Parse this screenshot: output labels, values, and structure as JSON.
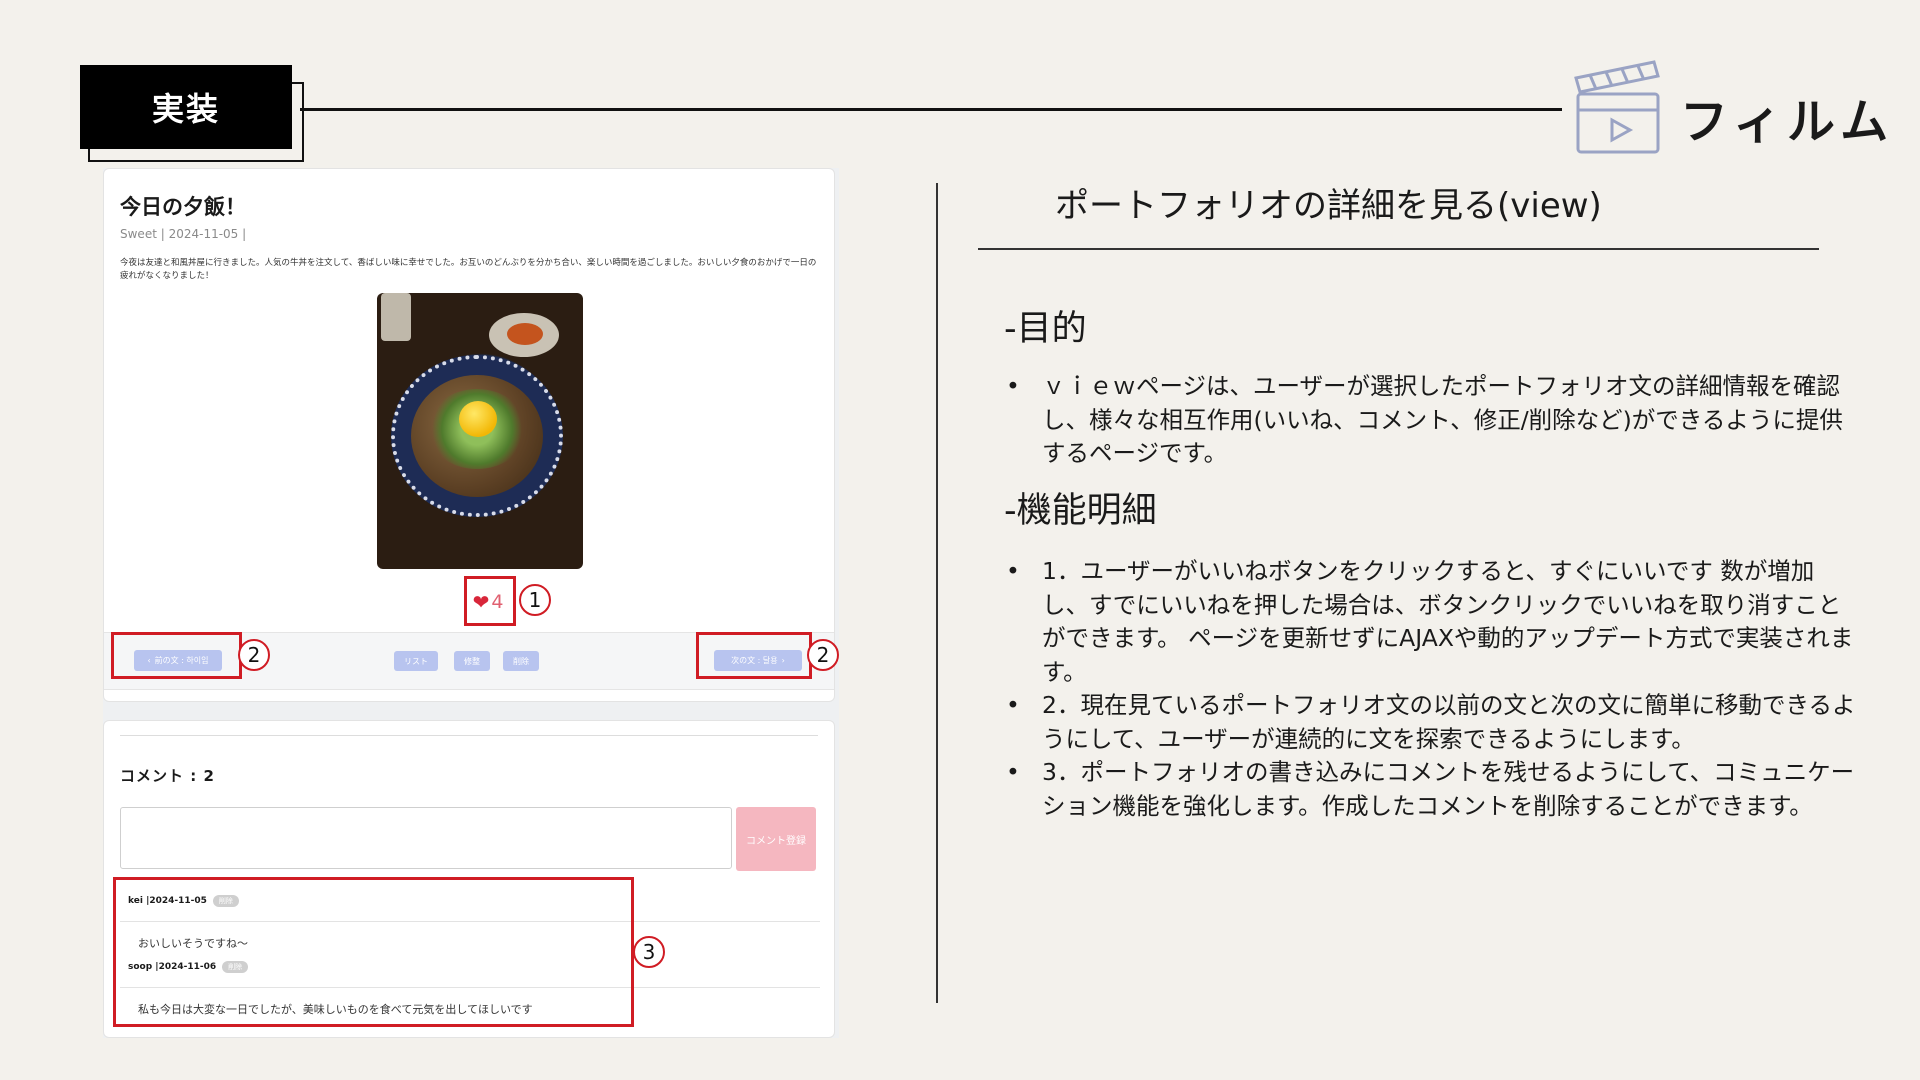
{
  "header": {
    "tag": "実装",
    "brand": "フィルム"
  },
  "post": {
    "title": "今日の夕飯！",
    "meta": "Sweet | 2024-11-05 |",
    "body": "今夜は友達と和風丼屋に行きました。人気の牛丼を注文して、香ばしい味に幸せでした。お互いのどんぶりを分かち合い、楽しい時間を過ごしました。おいしい夕食のおかげで一日の疲れがなくなりました！",
    "like_icon": "heart-icon",
    "like_count": "4",
    "prev_label": "前の文 : 하이임",
    "next_label": "次の文 : 달용",
    "list_label": "リスト",
    "edit_label": "修整",
    "delete_label": "削除"
  },
  "comments": {
    "count_label": "コメント : 2",
    "submit_label": "コメント登録",
    "items": [
      {
        "author_date": "kei |2024-11-05",
        "delete": "削除",
        "text": "おいしいそうですね～"
      },
      {
        "author_date": "soop |2024-11-06",
        "delete": "削除",
        "text": "私も今日は大変な一日でしたが、美味しいものを食べて元気を出してほしいです"
      }
    ]
  },
  "annotations": {
    "n1": "1",
    "n2": "2",
    "n3": "3"
  },
  "description": {
    "title": "ポートフォリオの詳細を見る(view)",
    "purpose_heading": "-目的",
    "purpose_text": "ｖｉｅｗページは、ユーザーが選択したポートフォリオ文の詳細情報を確認し、様々な相互作用(いいね、コメント、修正/削除など)ができるように提供するページです。",
    "features_heading": "-機能明細",
    "features": [
      "1．ユーザーがいいねボタンをクリックすると、すぐにいいです 数が増加し、すでにいいねを押した場合は、ボタンクリックでいいねを取り消すことができます。 ページを更新せずにAJAXや動的アップデート方式で実装されます。",
      "2．現在見ているポートフォリオ文の以前の文と次の文に簡単に移動できるようにして、ユーザーが連続的に文を探索できるようにします。",
      "3．ポートフォリオの書き込みにコメントを残せるようにして、コミュニケーション機能を強化します。作成したコメントを削除することができます。"
    ]
  },
  "colors": {
    "annotation_red": "#d01c24",
    "like_red": "#d8263a",
    "chip_blue": "#b8c4ef",
    "submit_pink": "#f5b7c0",
    "background": "#f3f1ec"
  }
}
